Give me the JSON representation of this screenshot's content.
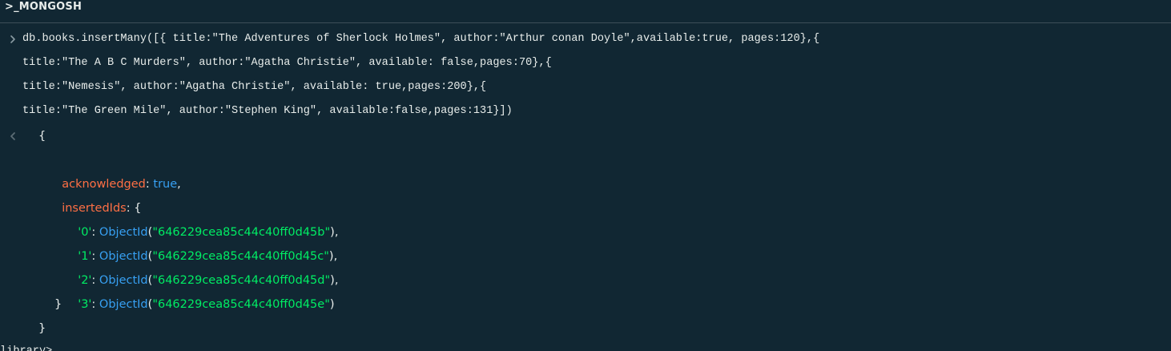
{
  "header": {
    "title": ">_MONGOSH"
  },
  "input": {
    "lines": [
      "db.books.insertMany([{ title:\"The Adventures of Sherlock Holmes\", author:\"Arthur conan Doyle\",available:true, pages:120},{",
      "title:\"The A B C Murders\", author:\"Agatha Christie\", available: false,pages:70},{",
      "title:\"Nemesis\", author:\"Agatha Christie\", available: true,pages:200},{",
      "title:\"The Green Mile\", author:\"Stephen King\", available:false,pages:131}])"
    ]
  },
  "output": {
    "open_brace": "{",
    "acknowledged_key": "acknowledged",
    "acknowledged_value": "true",
    "inserted_ids_key": "insertedIds",
    "inserted_ids_open": "{",
    "ids": [
      {
        "key": "'0'",
        "fn": "ObjectId",
        "value": "\"646229cea85c44c40ff0d45b\"",
        "trail": "),"
      },
      {
        "key": "'1'",
        "fn": "ObjectId",
        "value": "\"646229cea85c44c40ff0d45c\"",
        "trail": "),"
      },
      {
        "key": "'2'",
        "fn": "ObjectId",
        "value": "\"646229cea85c44c40ff0d45d\"",
        "trail": "),"
      },
      {
        "key": "'3'",
        "fn": "ObjectId",
        "value": "\"646229cea85c44c40ff0d45e\"",
        "trail": ")"
      }
    ],
    "inner_close": "}",
    "outer_close": "}"
  },
  "next_prompt": {
    "text": "library> "
  },
  "colors": {
    "background": "#112733",
    "key_red": "#ff6f44",
    "key_green": "#00ed64",
    "value_blue": "#37a0f2",
    "string_green": "#00ed64"
  },
  "icons": {
    "prompt": "chevron-right-icon",
    "result": "chevron-left-icon"
  }
}
